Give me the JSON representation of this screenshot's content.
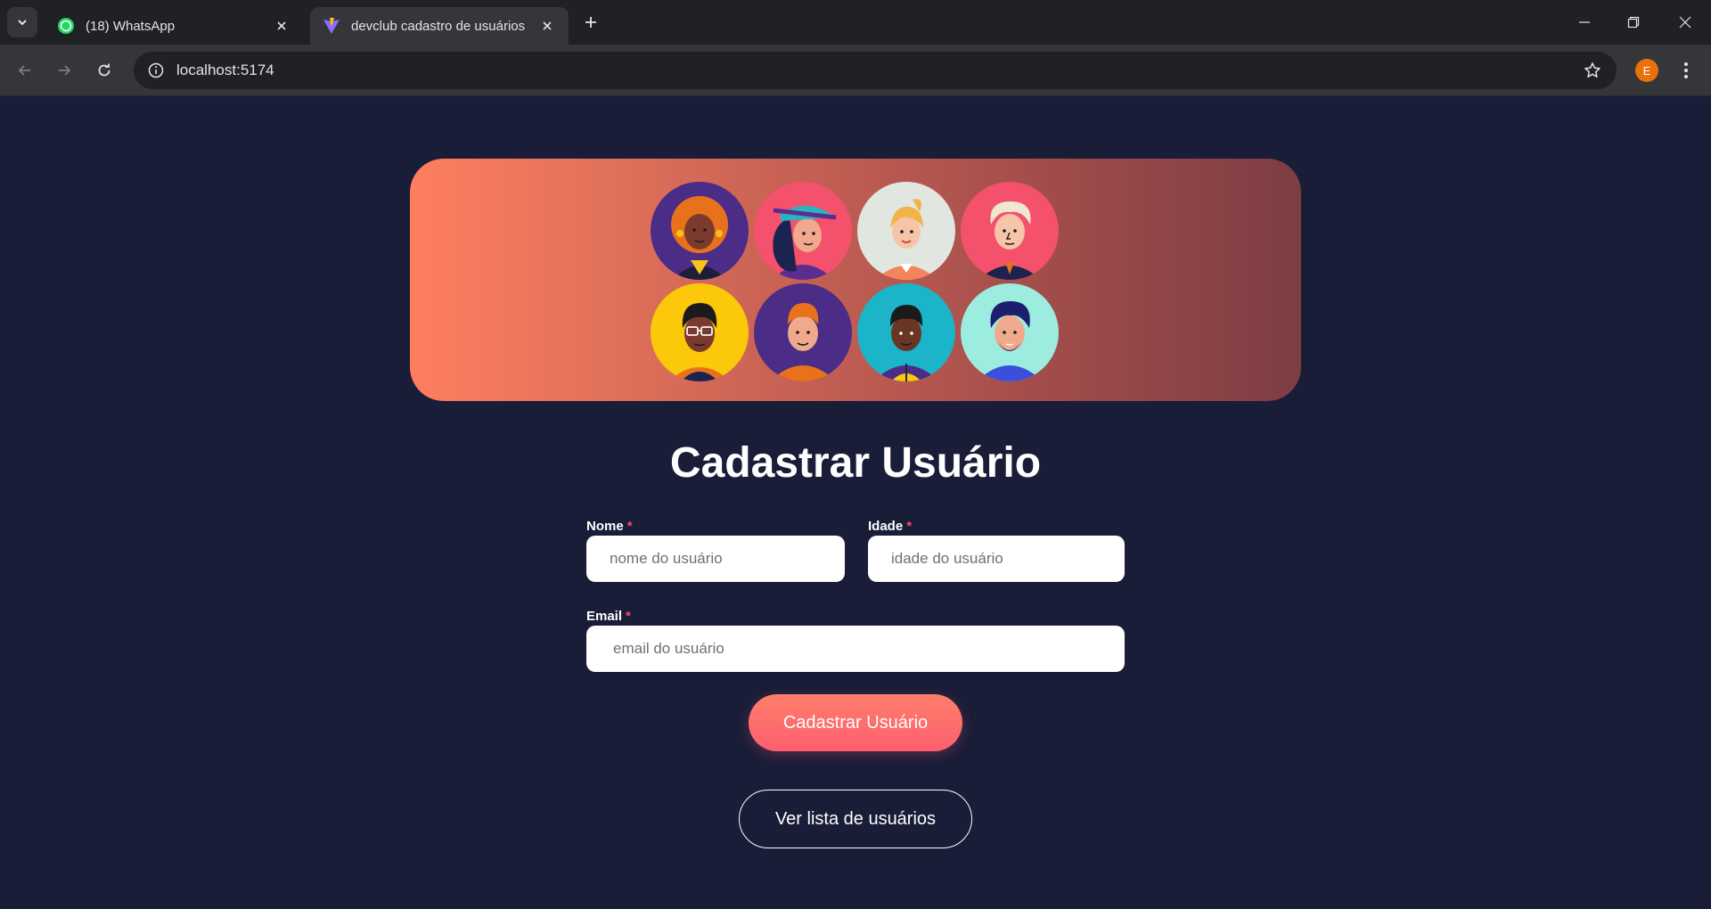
{
  "browser": {
    "tabs": [
      {
        "title": "(18) WhatsApp",
        "favicon": "whatsapp-icon",
        "active": false
      },
      {
        "title": "devclub cadastro de usuários",
        "favicon": "vite-icon",
        "active": true
      }
    ],
    "url": "localhost:5174",
    "profile_initial": "E"
  },
  "banner": {
    "avatar_count": 8
  },
  "form": {
    "title": "Cadastrar Usuário",
    "name_label": "Nome",
    "name_placeholder": "nome do usuário",
    "age_label": "Idade",
    "age_placeholder": "idade do usuário",
    "email_label": "Email",
    "email_placeholder": "email do usuário",
    "required_mark": "*",
    "submit_label": "Cadastrar Usuário",
    "list_link_label": "Ver lista de usuários"
  },
  "colors": {
    "page_background": "#1a1d38",
    "banner_gradient_start": "#fe7e5f",
    "banner_gradient_end": "#7d3d44",
    "primary_button": "#fe6f6d",
    "required_mark": "#ff4b5c"
  }
}
